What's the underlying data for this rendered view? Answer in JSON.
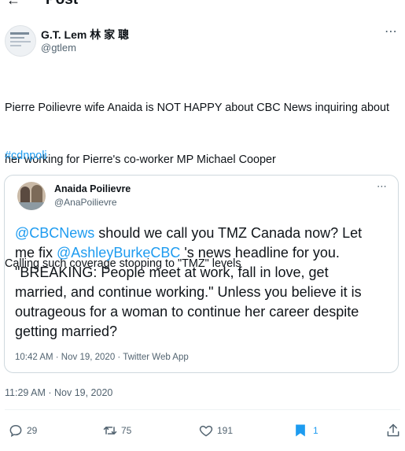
{
  "header": {
    "title": "Post",
    "back_icon": "arrow-left-icon"
  },
  "author": {
    "name": "G.T. Lem 林 家 聰",
    "handle": "@gtlem",
    "more_icon": "more-horizontal-icon"
  },
  "tweet": {
    "lines": [
      "Pierre Poilievre wife Anaida is NOT HAPPY about CBC News inquiring about",
      "her working for Pierre's co-worker MP Michael Cooper",
      "",
      "Calling such coverage stooping to \"TMZ\" levels"
    ],
    "hashtag": "#cdnpoli"
  },
  "quote": {
    "name": "Anaida Poilievre",
    "handle": "@AnaPoilievre",
    "more_icon": "more-horizontal-icon",
    "line1_mention": "@CBCNews",
    "line1_rest": " should we call you TMZ Canada now? Let",
    "line2_start": "me fix ",
    "line2_mention": "@AshleyBurkeCBC",
    "line2_rest": " 's news headline for you.",
    "lines_rest": [
      "\"BREAKING: People meet at work, fall in love, get",
      "married, and continue working.\" Unless you believe it is",
      "outrageous for a woman to continue her career despite",
      "getting married?"
    ],
    "meta": "10:42 AM · Nov 19, 2020 · Twitter Web App"
  },
  "timestamp": "11:29 AM · Nov 19, 2020",
  "actions": {
    "replies": "29",
    "retweets": "75",
    "likes": "191",
    "bookmarks": "1"
  },
  "colors": {
    "accent": "#1d9bf0",
    "muted": "#536471",
    "text": "#0f1419",
    "border": "#cfd9de"
  }
}
